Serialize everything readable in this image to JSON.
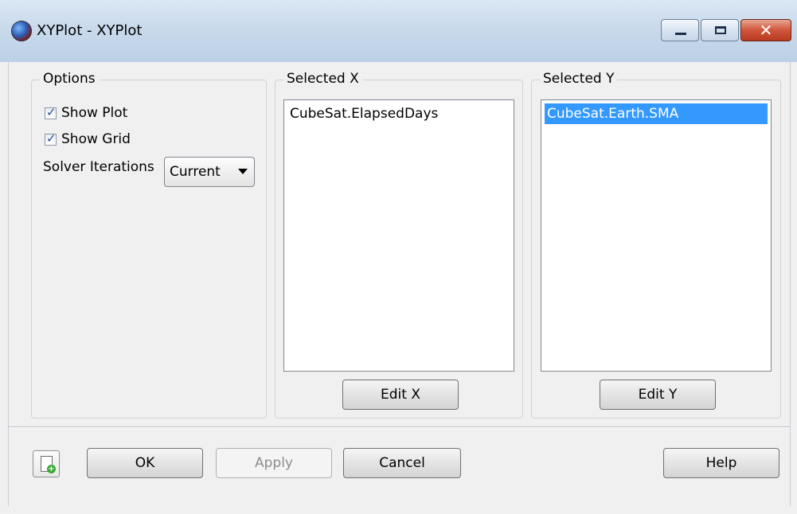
{
  "window": {
    "title": "XYPlot - XYPlot",
    "caption": {
      "close_glyph": "✕"
    }
  },
  "options": {
    "group_label": "Options",
    "show_plot": {
      "label": "Show Plot",
      "checked": true
    },
    "show_grid": {
      "label": "Show Grid",
      "checked": true
    },
    "solver_iterations": {
      "label": "Solver Iterations",
      "value": "Current"
    }
  },
  "selected_x": {
    "group_label": "Selected X",
    "items": [
      "CubeSat.ElapsedDays"
    ],
    "edit_button": "Edit X"
  },
  "selected_y": {
    "group_label": "Selected Y",
    "items": [
      "CubeSat.Earth.SMA"
    ],
    "edit_button": "Edit Y"
  },
  "footer": {
    "ok": "OK",
    "apply": "Apply",
    "cancel": "Cancel",
    "help": "Help"
  },
  "colors": {
    "selection": "#3399ff",
    "close_button": "#c8472d"
  }
}
